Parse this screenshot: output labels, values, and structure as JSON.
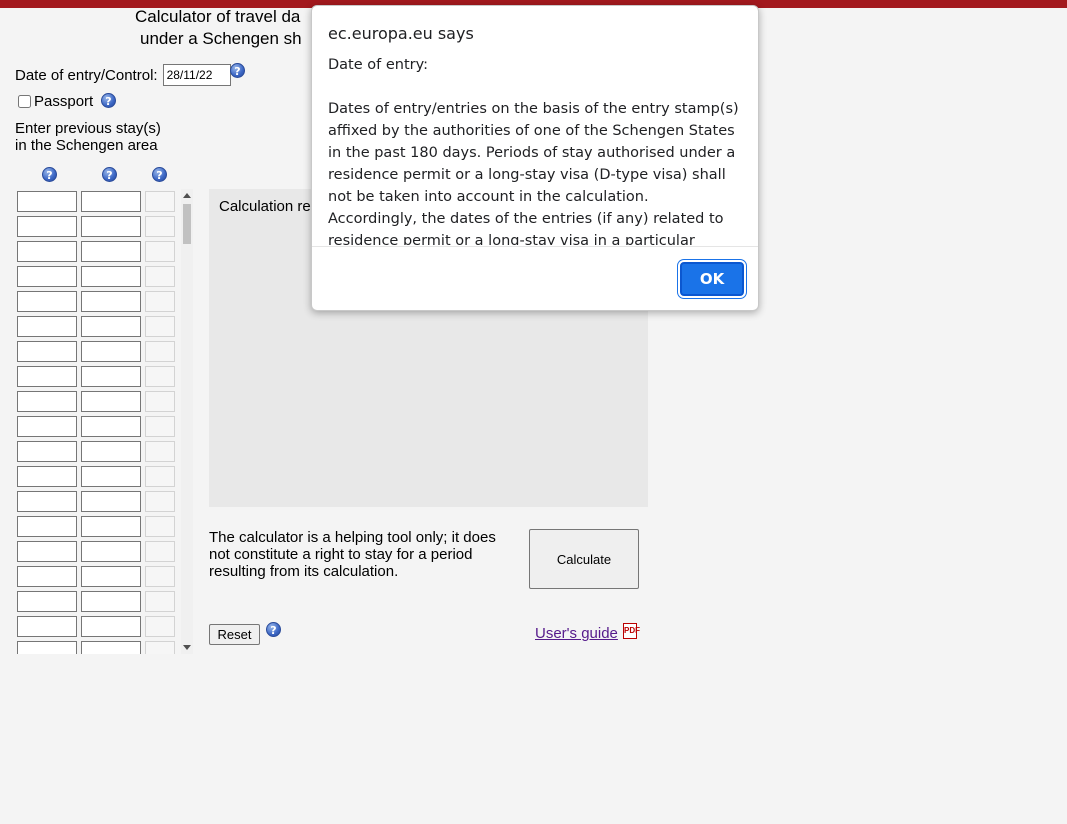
{
  "page": {
    "title_line1": "Calculator of travel da",
    "title_line2": "under a Schengen sh",
    "entry_label": "Date of entry/Control:",
    "entry_value": "28/11/22",
    "passport_label": "Passport",
    "prev_stays_line1": "Enter previous stay(s)",
    "prev_stays_line2": "in the Schengen area",
    "result_label": "Calculation re",
    "disclaimer": "The calculator is a helping tool only; it does not constitute a right to stay for a period resulting from its calculation.",
    "calculate_label": "Calculate",
    "reset_label": "Reset",
    "users_guide_label": "User's guide",
    "help_glyph": "?",
    "pdf_glyph": "PDF",
    "accent_color": "#a3191e"
  },
  "dialog": {
    "origin": "ec.europa.eu says",
    "message": "Date of entry:\n\nDates of entry/entries on the basis of the entry stamp(s) affixed by the authorities of one of the Schengen States in the past 180 days. Periods of stay authorised under a residence permit or a long-stay visa (D-type visa) shall not be taken into account in the calculation. Accordingly, the dates of the entries (if any) related to residence permit or a long-stay visa in a particular Schengen State shall not be",
    "ok_label": "OK"
  },
  "icons": {
    "help": "help-question-icon",
    "pdf": "pdf-file-icon"
  }
}
